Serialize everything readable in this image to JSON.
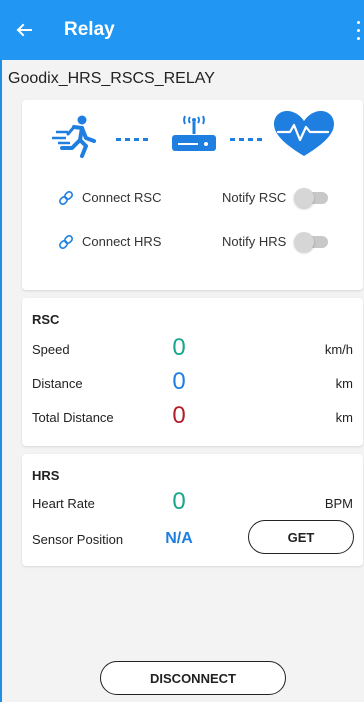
{
  "appbar": {
    "title": "Relay"
  },
  "device": {
    "name": "Goodix_HRS_RSCS_RELAY"
  },
  "relay": {
    "connect_rsc": "Connect RSC",
    "notify_rsc": "Notify RSC",
    "notify_rsc_on": false,
    "connect_hrs": "Connect HRS",
    "notify_hrs": "Notify HRS",
    "notify_hrs_on": false
  },
  "rsc": {
    "title": "RSC",
    "rows": [
      {
        "label": "Speed",
        "value": "0",
        "unit": "km/h"
      },
      {
        "label": "Distance",
        "value": "0",
        "unit": "km"
      },
      {
        "label": "Total Distance",
        "value": "0",
        "unit": "km"
      }
    ]
  },
  "hrs": {
    "title": "HRS",
    "heart_rate_label": "Heart Rate",
    "heart_rate_value": "0",
    "heart_rate_unit": "BPM",
    "sensor_position_label": "Sensor Position",
    "sensor_position_value": "N/A",
    "get_label": "GET"
  },
  "footer": {
    "disconnect_label": "DISCONNECT"
  },
  "colors": {
    "appbar": "#2196f3",
    "accent_blue": "#1f7fe0",
    "value_green": "#1aa58c",
    "value_red": "#b01e2a"
  }
}
